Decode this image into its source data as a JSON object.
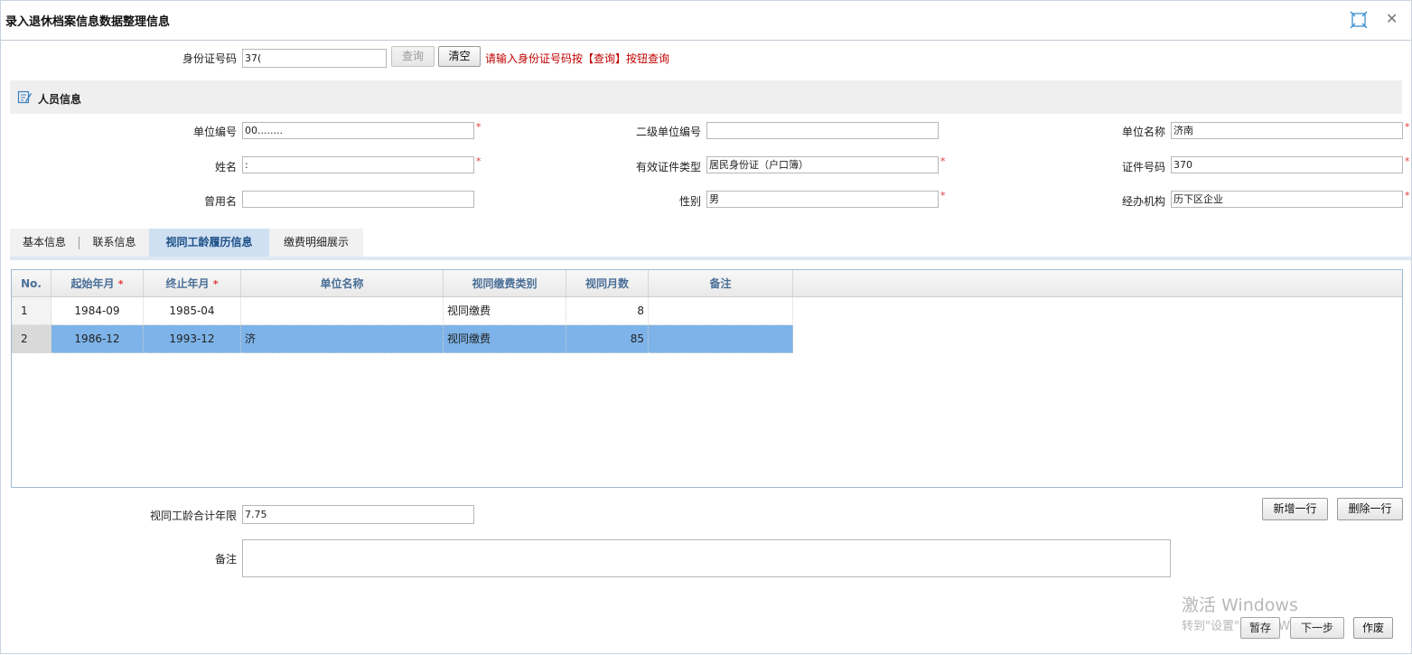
{
  "window": {
    "title": "录入退休档案信息数据整理信息",
    "maximize_icon": "maximize-icon",
    "close_icon": "close-icon",
    "close_symbol": "✕"
  },
  "search": {
    "id_label": "身份证号码",
    "id_value": "37(",
    "query_label": "查询",
    "clear_label": "清空",
    "hint": "请输入身份证号码按【查询】按钮查询"
  },
  "section": {
    "title": "人员信息",
    "icon": "edit-icon"
  },
  "fields": {
    "unit_code_label": "单位编号",
    "unit_code_value": "00........",
    "sub_unit_code_label": "二级单位编号",
    "sub_unit_code_value": "",
    "unit_name_label": "单位名称",
    "unit_name_value": "济南",
    "name_label": "姓名",
    "name_value": ":",
    "cert_type_label": "有效证件类型",
    "cert_type_value": "居民身份证（户口簿）",
    "cert_no_label": "证件号码",
    "cert_no_value": "370",
    "former_name_label": "曾用名",
    "former_name_value": "",
    "gender_label": "性别",
    "gender_value": "男",
    "agency_label": "经办机构",
    "agency_value": "历下区企业",
    "required_mark": "*"
  },
  "tabs": [
    {
      "label": "基本信息"
    },
    {
      "label": "联系信息"
    },
    {
      "label": "视同工龄履历信息"
    },
    {
      "label": "缴费明细展示"
    }
  ],
  "table": {
    "columns": [
      "No.",
      "起始年月",
      "终止年月",
      "单位名称",
      "视同缴费类别",
      "视同月数",
      "备注"
    ],
    "required_mark": "*",
    "rows": [
      {
        "no": "1",
        "start": "1984-09",
        "end": "1985-04",
        "unit": "",
        "type": "视同缴费",
        "months": "8",
        "note": ""
      },
      {
        "no": "2",
        "start": "1986-12",
        "end": "1993-12",
        "unit": "济",
        "type": "视同缴费",
        "months": "85",
        "note": ""
      }
    ]
  },
  "footer": {
    "total_label": "视同工龄合计年限",
    "total_value": "7.75",
    "note_label": "备注",
    "note_value": "",
    "add_row_label": "新增一行",
    "delete_row_label": "删除一行",
    "save_label": "暂存",
    "next_label": "下一步",
    "void_label": "作废"
  },
  "watermark": {
    "line1": "激活 Windows",
    "line2": "转到\"设置\"以激活 Windows。"
  }
}
